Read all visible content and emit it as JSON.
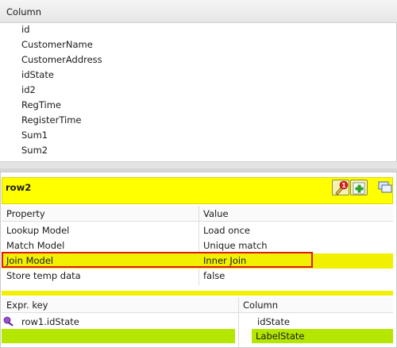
{
  "columns_panel": {
    "header": "Column",
    "items": [
      "id",
      "CustomerName",
      "CustomerAddress",
      "idState",
      "id2",
      "RegTime",
      "RegisterTime",
      "Sum1",
      "Sum2"
    ]
  },
  "row_panel": {
    "title": "row2",
    "badge": "1",
    "properties": {
      "headers": {
        "property": "Property",
        "value": "Value"
      },
      "rows": [
        {
          "property": "Lookup Model",
          "value": "Load once"
        },
        {
          "property": "Match Model",
          "value": "Unique match"
        },
        {
          "property": "Join Model",
          "value": "Inner Join"
        },
        {
          "property": "Store temp data",
          "value": "false"
        }
      ]
    },
    "expressions": {
      "headers": {
        "key": "Expr. key",
        "column": "Column"
      },
      "rows": [
        {
          "key": "row1.idState",
          "column": "idState"
        },
        {
          "key": "",
          "column": "LabelState"
        }
      ]
    }
  },
  "colors": {
    "highlight_yellow": "#f0f000",
    "header_yellow": "#ffff00",
    "lime": "#b4e600",
    "error_red": "#e01818"
  }
}
